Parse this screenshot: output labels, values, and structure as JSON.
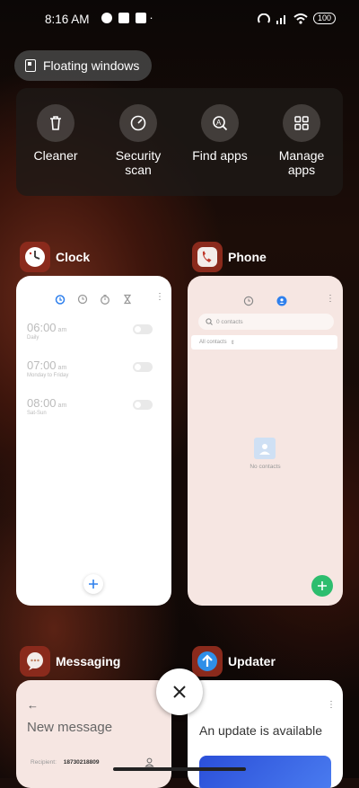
{
  "status": {
    "time": "8:16 AM",
    "battery": "100"
  },
  "floating": {
    "label": "Floating windows"
  },
  "tools": [
    {
      "label": "Cleaner",
      "icon": "trash-icon"
    },
    {
      "label": "Security scan",
      "icon": "gauge-icon"
    },
    {
      "label": "Find apps",
      "icon": "search-apps-icon"
    },
    {
      "label": "Manage apps",
      "icon": "grid-icon"
    }
  ],
  "apps": {
    "clock": {
      "name": "Clock",
      "alarms": [
        {
          "time": "06:00",
          "ampm": "am",
          "sub": "Daily"
        },
        {
          "time": "07:00",
          "ampm": "am",
          "sub": "Monday to Friday"
        },
        {
          "time": "08:00",
          "ampm": "am",
          "sub": "Sat-Sun"
        }
      ]
    },
    "phone": {
      "name": "Phone",
      "search_placeholder": "0 contacts",
      "filter": "All contacts",
      "empty": "No contacts"
    },
    "messaging": {
      "name": "Messaging",
      "title": "New message",
      "recipient_label": "Recipient:",
      "recipient": "18730218809"
    },
    "updater": {
      "name": "Updater",
      "title": "An update is available"
    }
  },
  "colors": {
    "accent_blue": "#2f80ed",
    "phone_green": "#2dbd6e"
  }
}
